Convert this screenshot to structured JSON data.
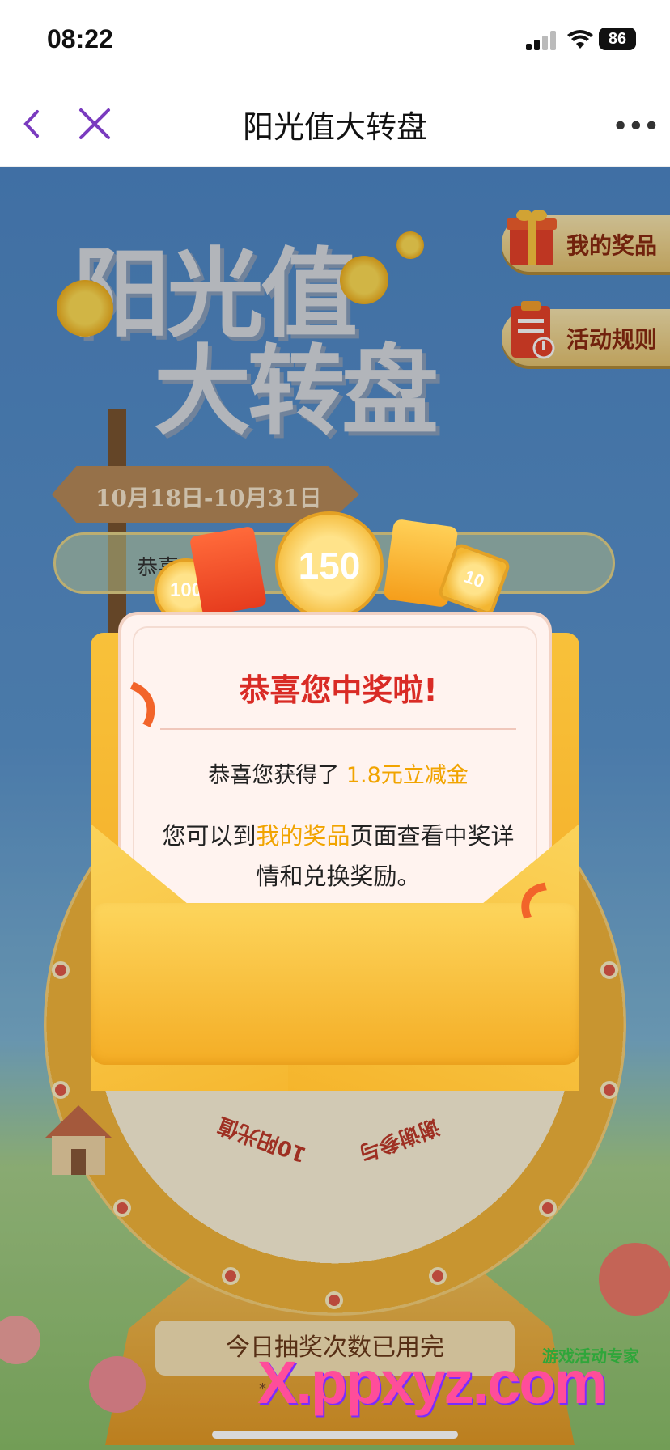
{
  "status_bar": {
    "time": "08:22",
    "battery": "86"
  },
  "nav": {
    "title": "阳光值大转盘"
  },
  "hero": {
    "title_part1": "阳光值",
    "title_part2": "大转盘",
    "date_range": "10月18日-10月31日",
    "notice_prefix": "恭喜"
  },
  "side_buttons": [
    {
      "label": "我的奖品"
    },
    {
      "label": "活动规则"
    }
  ],
  "prize_pile": {
    "coin_big": "150",
    "coin_small": "100",
    "ticket": "10"
  },
  "wheel": {
    "segments": [
      "10阳光值",
      "谢谢参与"
    ]
  },
  "modal": {
    "title": "恭喜您中奖啦!",
    "prize_prefix": "恭喜您获得了 ",
    "prize_value": "1.8元立减金",
    "detail_prefix": "您可以到",
    "detail_link": "我的奖品",
    "detail_suffix": "页面查看中奖详",
    "detail_line2": "情和兑换奖励。"
  },
  "draw_status": "今日抽奖次数已用完",
  "watermark": {
    "main": "X.ppxyz.com",
    "small": "游戏活动专家"
  },
  "colors": {
    "accent": "#d92b25",
    "highlight": "#f1a400",
    "envelope": "#f5b52c",
    "sky": "#5b95cf"
  }
}
